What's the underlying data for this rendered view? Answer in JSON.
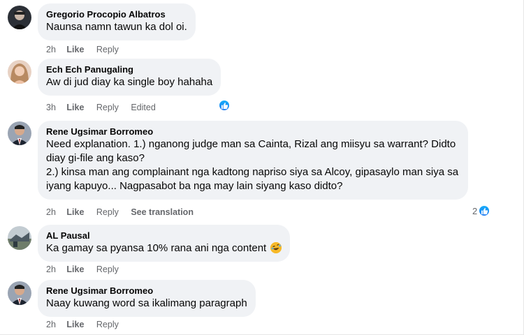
{
  "comments": [
    {
      "author": "Gregorio Procopio Albatros",
      "lines": [
        "Naunsa namn tawun ka dol oi."
      ],
      "time": "2h",
      "like": "Like",
      "reply": "Reply"
    },
    {
      "author": "Ech Ech Panugaling",
      "lines": [
        "Aw di jud diay ka single boy hahaha"
      ],
      "time": "3h",
      "like": "Like",
      "reply": "Reply",
      "edited": "Edited",
      "reaction": "like"
    },
    {
      "author": "Rene Ugsimar Borromeo",
      "lines": [
        "Need explanation. 1.) nganong judge man sa Cainta, Rizal ang miisyu sa warrant? Didto",
        "diay gi-file ang kaso?",
        "2.) kinsa man ang complainant nga kadtong napriso siya sa Alcoy, gipasaylo man siya sa",
        "iyang kapuyo... Nagpasabot ba nga may lain siyang kaso didto?"
      ],
      "time": "2h",
      "like": "Like",
      "reply": "Reply",
      "see_translation": "See translation",
      "reaction": "like",
      "reaction_count": "2"
    },
    {
      "author": "AL Pausal",
      "lines": [
        "Ka gamay sa pyansa 10% rana ani nga content"
      ],
      "emoji": "rolling-on-floor-laughing-emoji",
      "time": "2h",
      "like": "Like",
      "reply": "Reply"
    },
    {
      "author": "Rene Ugsimar Borromeo",
      "lines": [
        "Naay kuwang word sa ikalimang paragraph"
      ],
      "time": "2h",
      "like": "Like",
      "reply": "Reply"
    }
  ],
  "colors": {
    "bubble": "#f0f2f5",
    "secondary_text": "#65676b",
    "like_blue": "#1877f2"
  }
}
